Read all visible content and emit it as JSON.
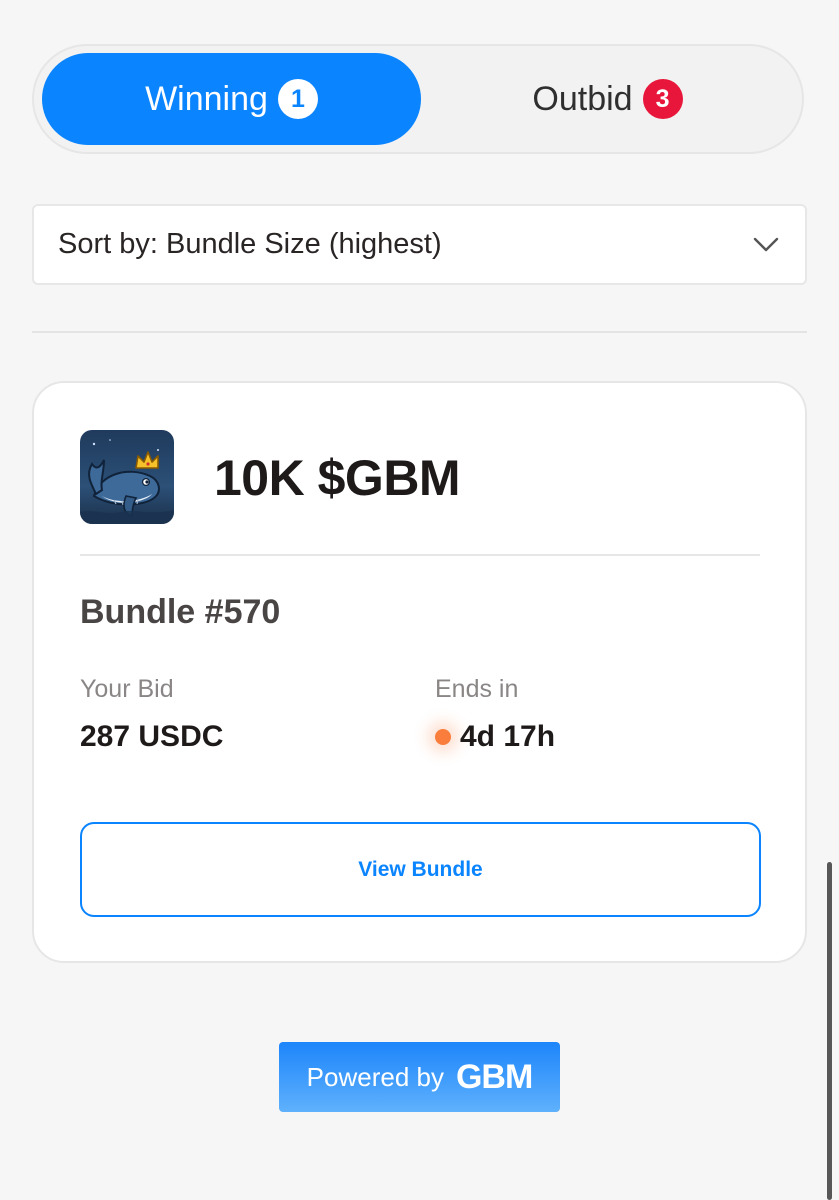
{
  "tabs": [
    {
      "label": "Winning",
      "count": "1",
      "active": true
    },
    {
      "label": "Outbid",
      "count": "3",
      "active": false
    }
  ],
  "sort": {
    "label": "Sort by: Bundle Size (highest)",
    "icon": "chevron-down-icon"
  },
  "bundle": {
    "token_name": "10K $GBM",
    "token_icon": "whale-crown-icon",
    "title": "Bundle #570",
    "your_bid_label": "Your Bid",
    "your_bid_value": "287 USDC",
    "ends_in_label": "Ends in",
    "ends_in_value": "4d 17h",
    "view_button": "View Bundle"
  },
  "footer": {
    "powered_by": "Powered by",
    "brand": "GBM"
  },
  "colors": {
    "accent": "#0a84ff",
    "badge_red": "#e8163a",
    "live_dot": "#fb7d3c",
    "background": "#f6f6f6"
  }
}
